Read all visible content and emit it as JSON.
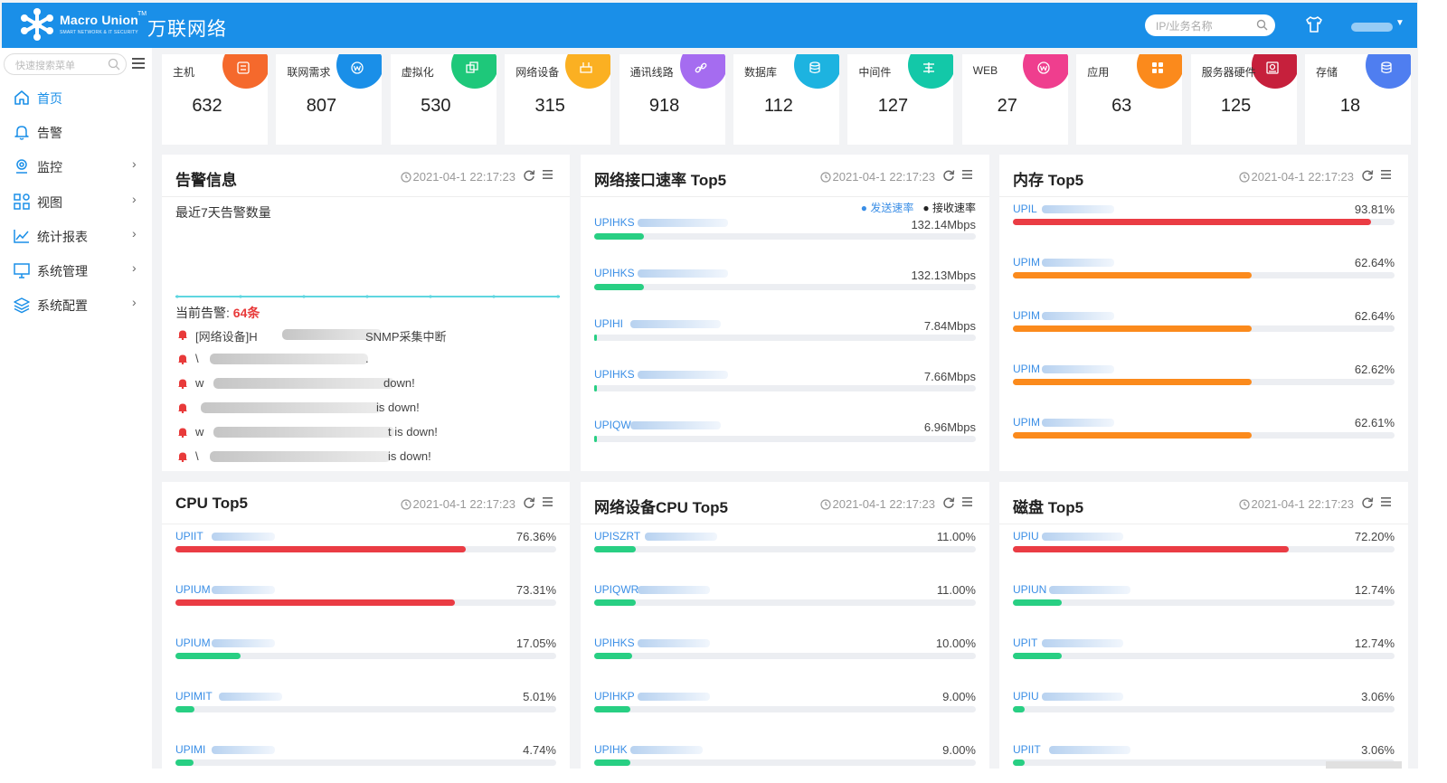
{
  "header": {
    "logo_en": "Macro Union",
    "logo_tm": "TM",
    "logo_sub": "SMART NETWORK & IT SECURITY",
    "logo_cn": "万联网络",
    "search_placeholder": "IP/业务名称"
  },
  "sidebar": {
    "search_placeholder": "快速搜索菜单",
    "items": [
      {
        "label": "首页",
        "icon": "home-icon",
        "chevron": ""
      },
      {
        "label": "告警",
        "icon": "bell-icon",
        "chevron": ""
      },
      {
        "label": "监控",
        "icon": "location-icon",
        "chevron": "›"
      },
      {
        "label": "视图",
        "icon": "grid-icon",
        "chevron": "›"
      },
      {
        "label": "统计报表",
        "icon": "line-chart-icon",
        "chevron": "›"
      },
      {
        "label": "系统管理",
        "icon": "monitor-icon",
        "chevron": "›"
      },
      {
        "label": "系统配置",
        "icon": "layers-icon",
        "chevron": "›"
      }
    ]
  },
  "stats": [
    {
      "label": "主机",
      "value": "632",
      "color": "#f5692c",
      "icon": "server-icon"
    },
    {
      "label": "联网需求",
      "value": "807",
      "color": "#1a8fe8",
      "icon": "network-icon"
    },
    {
      "label": "虚拟化",
      "value": "530",
      "color": "#1ec87a",
      "icon": "copy-icon"
    },
    {
      "label": "网络设备",
      "value": "315",
      "color": "#fbb022",
      "icon": "router-icon"
    },
    {
      "label": "通讯线路",
      "value": "918",
      "color": "#a56cf0",
      "icon": "link-icon"
    },
    {
      "label": "数据库",
      "value": "112",
      "color": "#1db3e0",
      "icon": "database-icon"
    },
    {
      "label": "中间件",
      "value": "127",
      "color": "#13c8a8",
      "icon": "middleware-icon"
    },
    {
      "label": "WEB",
      "value": "27",
      "color": "#ef3e8e",
      "icon": "web-icon"
    },
    {
      "label": "应用",
      "value": "63",
      "color": "#fb8a1c",
      "icon": "apps-icon"
    },
    {
      "label": "服务器硬件",
      "value": "125",
      "color": "#c6203c",
      "icon": "hardware-icon"
    },
    {
      "label": "存储",
      "value": "18",
      "color": "#4f7ef0",
      "icon": "storage-icon"
    }
  ],
  "alarm": {
    "title": "告警信息",
    "time": "2021-04-1 22:17:23",
    "subtitle": "最近7天告警数量",
    "current_label": "当前告警:",
    "current_count": "64条",
    "items": [
      {
        "text": "[网络设备]H",
        "tail": "SNMP采集中断"
      },
      {
        "text": "\\",
        "tail": "."
      },
      {
        "text": "w",
        "tail": "down!"
      },
      {
        "text": "",
        "tail": "is down!"
      },
      {
        "text": "w",
        "tail": "t is down!"
      },
      {
        "text": "\\",
        "tail": "is down!"
      }
    ]
  },
  "net_rate": {
    "title": "网络接口速率 Top5",
    "time": "2021-04-1 22:17:23",
    "legend_send": "发送速率",
    "legend_recv": "接收速率",
    "rows": [
      {
        "name": "UPIHKS",
        "value": "132.14Mbps",
        "pct": 0.13
      },
      {
        "name": "UPIHKS",
        "value": "132.13Mbps",
        "pct": 0.13
      },
      {
        "name": "UPIHI",
        "value": "7.84Mbps",
        "pct": 0.004
      },
      {
        "name": "UPIHKS",
        "value": "7.66Mbps",
        "pct": 0.004
      },
      {
        "name": "UPIQW",
        "value": "6.96Mbps",
        "pct": 0.004
      }
    ]
  },
  "mem": {
    "title": "内存 Top5",
    "time": "2021-04-1 22:17:23",
    "rows": [
      {
        "name": "UPIL",
        "value": "93.81%",
        "pct": 0.9381,
        "color": "#ea3c44"
      },
      {
        "name": "UPIM",
        "value": "62.64%",
        "pct": 0.6264,
        "color": "#fb8a1c"
      },
      {
        "name": "UPIM",
        "value": "62.64%",
        "pct": 0.6264,
        "color": "#fb8a1c"
      },
      {
        "name": "UPIM",
        "value": "62.62%",
        "pct": 0.6262,
        "color": "#fb8a1c"
      },
      {
        "name": "UPIM",
        "value": "62.61%",
        "pct": 0.6261,
        "color": "#fb8a1c"
      }
    ]
  },
  "cpu": {
    "title": "CPU Top5",
    "time": "2021-04-1 22:17:23",
    "rows": [
      {
        "name": "UPIIT",
        "value": "76.36%",
        "pct": 0.7636,
        "color": "#ea3c44"
      },
      {
        "name": "UPIUM",
        "value": "73.31%",
        "pct": 0.7331,
        "color": "#ea3c44"
      },
      {
        "name": "UPIUM",
        "value": "17.05%",
        "pct": 0.1705,
        "color": "#28cf83"
      },
      {
        "name": "UPIMIT",
        "value": "5.01%",
        "pct": 0.0501,
        "color": "#28cf83"
      },
      {
        "name": "UPIMI",
        "value": "4.74%",
        "pct": 0.0474,
        "color": "#28cf83"
      }
    ]
  },
  "net_cpu": {
    "title": "网络设备CPU Top5",
    "time": "2021-04-1 22:17:23",
    "rows": [
      {
        "name": "UPISZRT",
        "value": "11.00%",
        "pct": 0.11,
        "color": "#28cf83"
      },
      {
        "name": "UPIQWR",
        "value": "11.00%",
        "pct": 0.11,
        "color": "#28cf83"
      },
      {
        "name": "UPIHKS",
        "value": "10.00%",
        "pct": 0.1,
        "color": "#28cf83"
      },
      {
        "name": "UPIHKP",
        "value": "9.00%",
        "pct": 0.09,
        "color": "#28cf83"
      },
      {
        "name": "UPIHK",
        "value": "9.00%",
        "pct": 0.09,
        "color": "#28cf83"
      }
    ]
  },
  "disk": {
    "title": "磁盘 Top5",
    "time": "2021-04-1 22:17:23",
    "rows": [
      {
        "name": "UPIU",
        "value": "72.20%",
        "pct": 0.722,
        "color": "#ea3c44"
      },
      {
        "name": "UPIUN",
        "value": "12.74%",
        "pct": 0.1274,
        "color": "#28cf83"
      },
      {
        "name": "UPIT",
        "value": "12.74%",
        "pct": 0.1274,
        "color": "#28cf83"
      },
      {
        "name": "UPIU",
        "value": "3.06%",
        "pct": 0.0306,
        "color": "#28cf83"
      },
      {
        "name": "UPIIT",
        "value": "3.06%",
        "pct": 0.0306,
        "color": "#28cf83"
      }
    ]
  }
}
